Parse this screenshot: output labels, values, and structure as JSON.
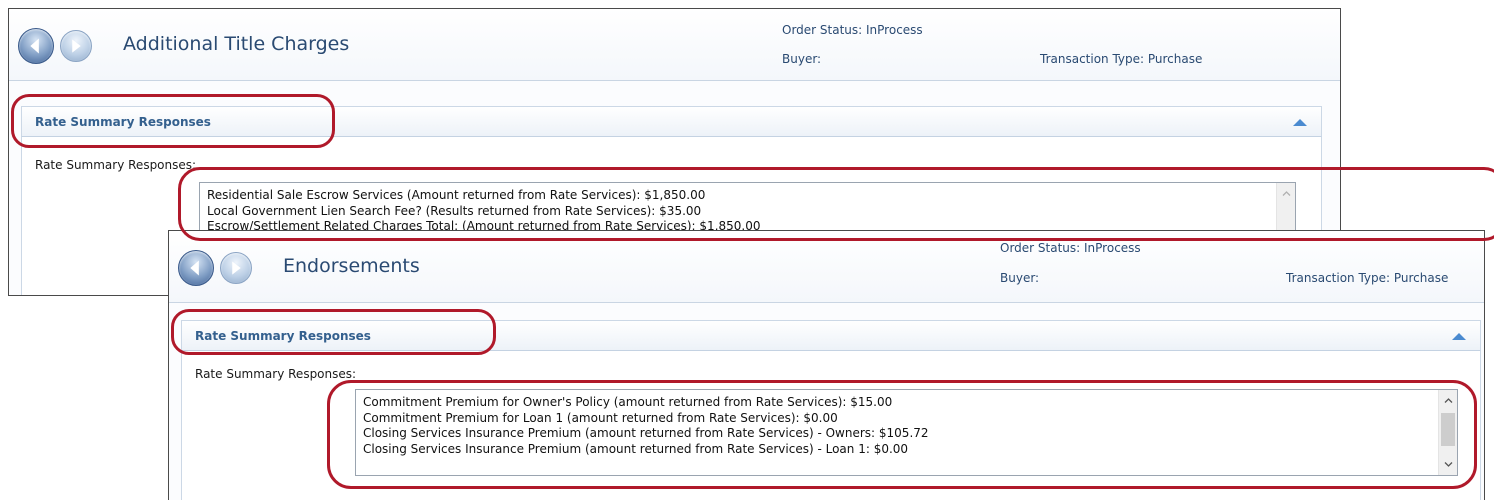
{
  "colors": {
    "annotation_ring": "#b0192a",
    "section_title": "#34608e",
    "header_text": "#2a4a72",
    "collapse_arrow": "#4a8ad0"
  },
  "panels": [
    {
      "title": "Additional Title Charges",
      "order_status": "Order Status: InProcess",
      "buyer": "Buyer:",
      "transaction_type": "Transaction Type: Purchase",
      "back_icon": "arrow-left-icon",
      "forward_icon": "arrow-right-icon",
      "section": {
        "title": "Rate Summary Responses",
        "collapse_icon": "collapse-up-icon",
        "field_label": "Rate Summary Responses:",
        "lines": [
          "Residential Sale Escrow Services (Amount returned from Rate Services): $1,850.00",
          "Local Government Lien Search Fee? (Results returned from Rate Services): $35.00",
          "Escrow/Settlement Related Charges Total: (Amount returned from Rate Services): $1,850.00"
        ]
      }
    },
    {
      "title": "Endorsements",
      "order_status": "Order Status: InProcess",
      "buyer": "Buyer:",
      "transaction_type": "Transaction Type: Purchase",
      "back_icon": "arrow-left-icon",
      "forward_icon": "arrow-right-icon",
      "section": {
        "title": "Rate Summary Responses",
        "collapse_icon": "collapse-up-icon",
        "field_label": "Rate Summary Responses:",
        "lines": [
          "Commitment Premium for Owner's Policy (amount returned from Rate Services): $15.00",
          "Commitment Premium for Loan 1 (amount returned from Rate Services): $0.00",
          "Closing Services Insurance Premium (amount returned from Rate Services) - Owners: $105.72",
          "Closing Services Insurance Premium (amount returned from Rate Services) - Loan 1: $0.00"
        ]
      }
    }
  ]
}
